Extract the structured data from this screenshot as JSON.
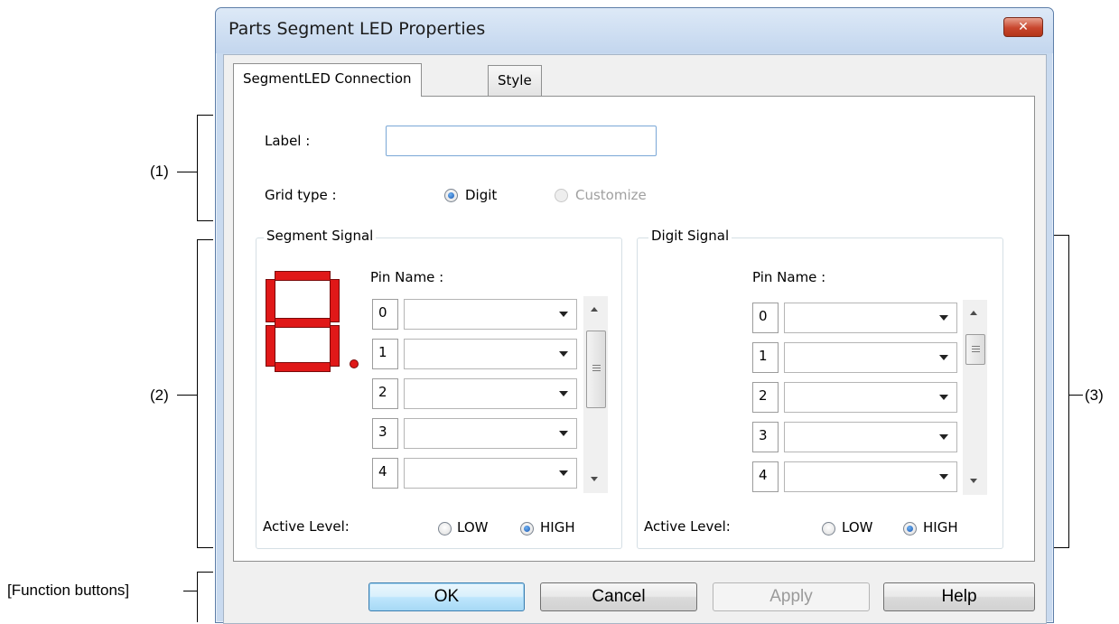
{
  "annotations": {
    "callout_1": "(1)",
    "callout_2": "(2)",
    "callout_3": "(3)",
    "callout_buttons": "[Function buttons]"
  },
  "window": {
    "title": "Parts Segment LED Properties",
    "close_glyph": "✕"
  },
  "tabs": [
    {
      "label": "SegmentLED Connection",
      "active": true
    },
    {
      "label": "Style",
      "active": false
    }
  ],
  "form": {
    "label_caption": "Label :",
    "label_value": "",
    "grid_type_caption": "Grid type :",
    "grid_type_options": [
      {
        "label": "Digit",
        "checked": true,
        "enabled": true
      },
      {
        "label": "Customize",
        "checked": false,
        "enabled": false
      }
    ]
  },
  "segment_signal": {
    "title": "Segment Signal",
    "pin_name_caption": "Pin Name :",
    "pins": [
      {
        "index": "0",
        "value": ""
      },
      {
        "index": "1",
        "value": ""
      },
      {
        "index": "2",
        "value": ""
      },
      {
        "index": "3",
        "value": ""
      },
      {
        "index": "4",
        "value": ""
      }
    ],
    "active_level_caption": "Active Level:",
    "active_level_options": [
      {
        "label": "LOW",
        "checked": false
      },
      {
        "label": "HIGH",
        "checked": true
      }
    ],
    "led_color": "#e01818"
  },
  "digit_signal": {
    "title": "Digit Signal",
    "pin_name_caption": "Pin Name :",
    "pins": [
      {
        "index": "0",
        "value": ""
      },
      {
        "index": "1",
        "value": ""
      },
      {
        "index": "2",
        "value": ""
      },
      {
        "index": "3",
        "value": ""
      },
      {
        "index": "4",
        "value": ""
      }
    ],
    "active_level_caption": "Active Level:",
    "active_level_options": [
      {
        "label": "LOW",
        "checked": false
      },
      {
        "label": "HIGH",
        "checked": true
      }
    ]
  },
  "buttons": {
    "ok": "OK",
    "cancel": "Cancel",
    "apply": "Apply",
    "help": "Help"
  },
  "icons": {
    "close": "close-icon",
    "dropdown": "chevron-down-icon",
    "scroll_up": "scroll-up-icon",
    "scroll_down": "scroll-down-icon",
    "segment_display": "seven-segment-led-icon"
  }
}
